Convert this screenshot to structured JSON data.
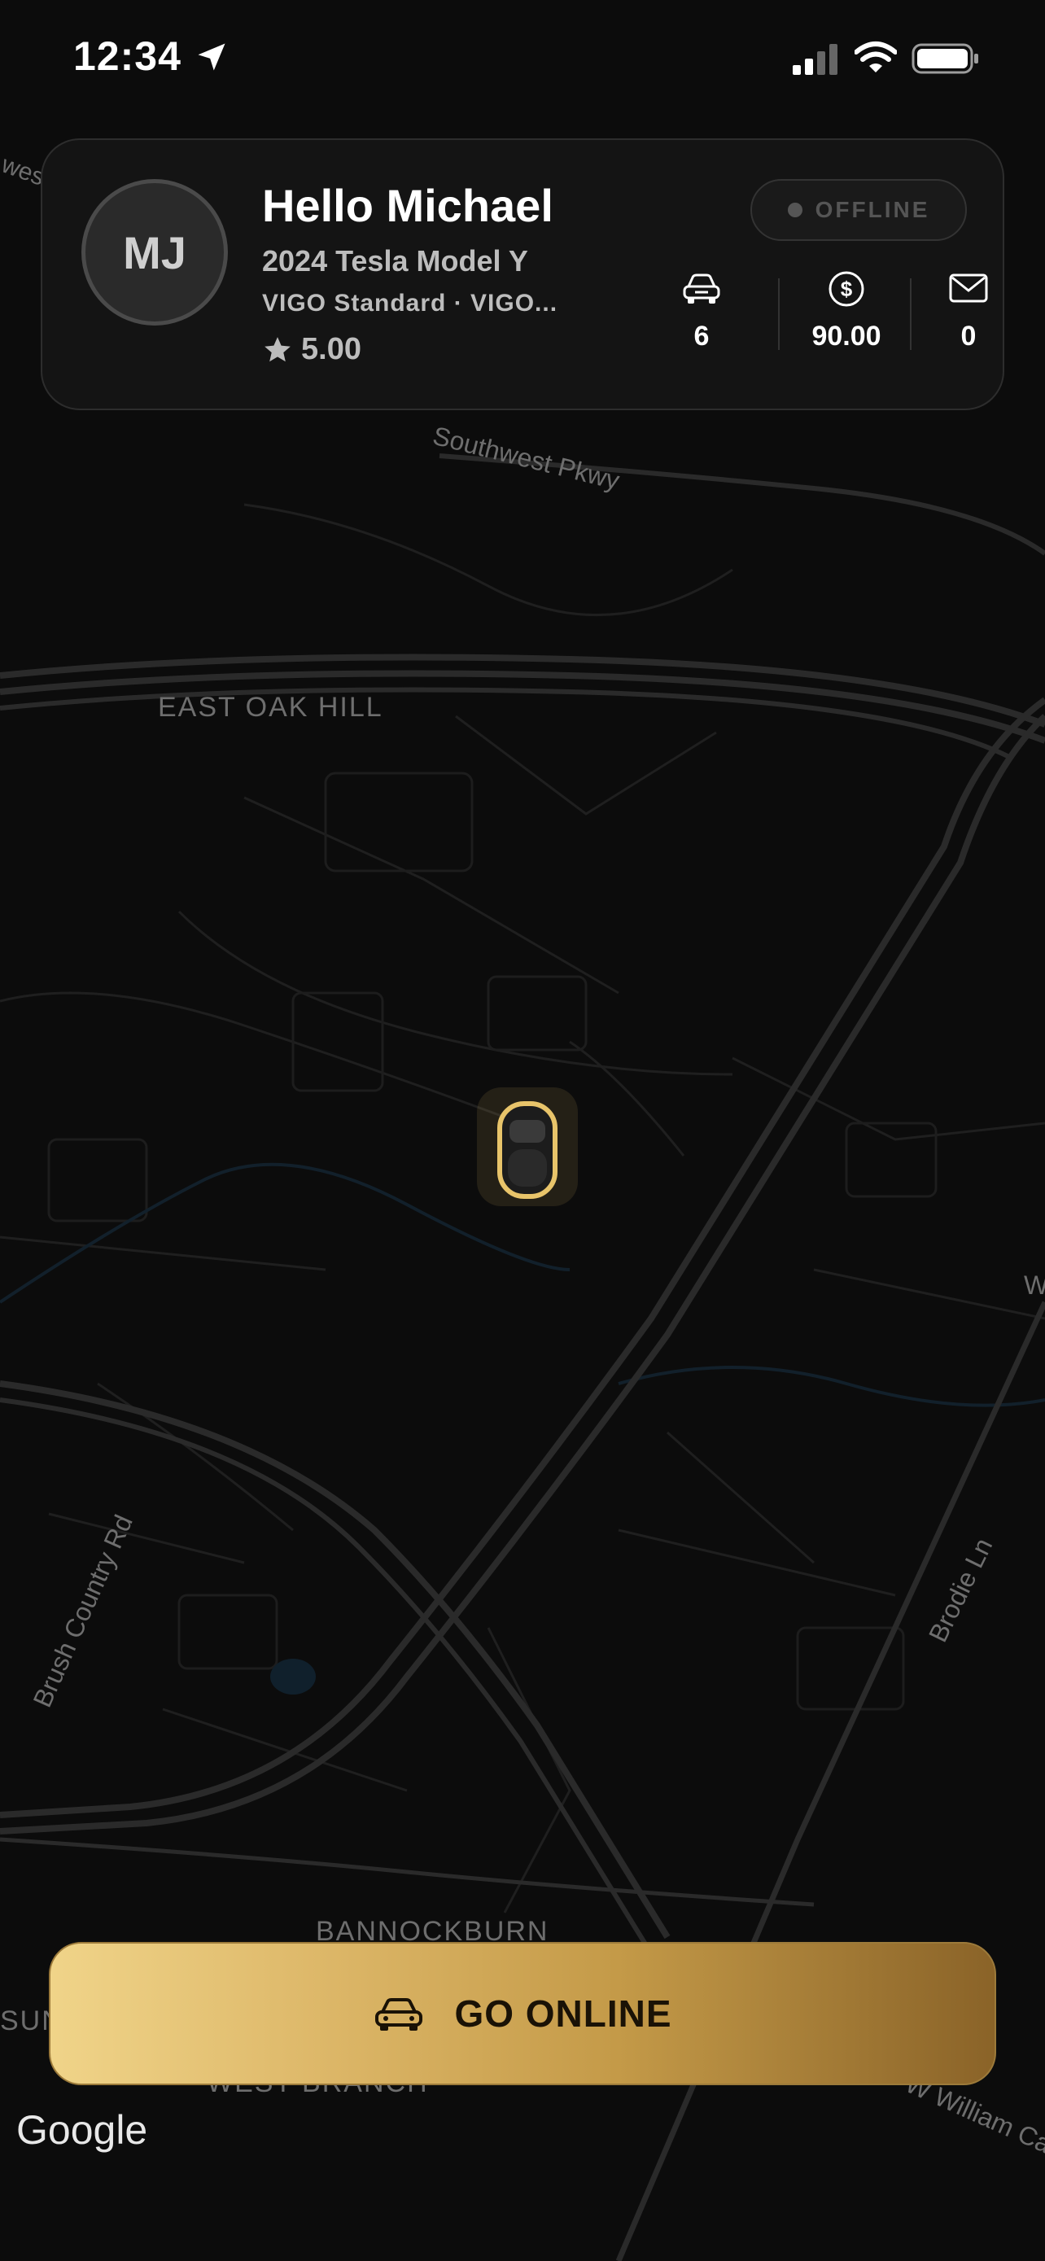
{
  "status_bar": {
    "time": "12:34"
  },
  "profile": {
    "initials": "MJ",
    "greeting": "Hello Michael",
    "vehicle": "2024 Tesla Model Y",
    "service": "VIGO Standard · VIGO...",
    "rating": "5.00",
    "status": "OFFLINE"
  },
  "stats": {
    "rides": "6",
    "earnings": "90.00",
    "messages": "0"
  },
  "map": {
    "labels": {
      "southwest_pkwy": "Southwest Pkwy",
      "east_oak_hill": "EAST OAK HILL",
      "brush_country": "Brush Country Rd",
      "brodie": "Brodie Ln",
      "bannockburn": "BANNOCKBURN",
      "west_branch": "WEST BRANCH",
      "william_cannon": "W William Can",
      "sun": "SUN",
      "west_partial": "west",
      "w_partial": "W"
    },
    "attribution": "Google"
  },
  "action": {
    "label": "GO ONLINE"
  },
  "colors": {
    "accent_gold": "#d9b365",
    "background": "#0c0c0c"
  },
  "icons": [
    "location-arrow-icon",
    "signal-icon",
    "wifi-icon",
    "battery-icon",
    "star-icon",
    "car-icon",
    "dollar-icon",
    "mail-icon",
    "vehicle-marker-icon"
  ]
}
